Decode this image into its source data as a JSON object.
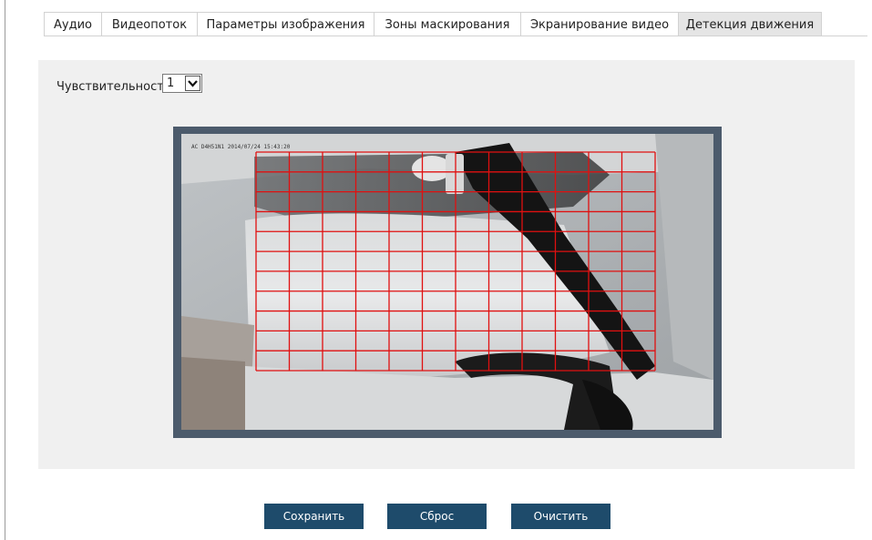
{
  "tabs": [
    {
      "label": "Аудио",
      "active": false
    },
    {
      "label": "Видеопоток",
      "active": false
    },
    {
      "label": "Параметры изображения",
      "active": false
    },
    {
      "label": "Зоны маскирования",
      "active": false
    },
    {
      "label": "Экранирование видео",
      "active": false
    },
    {
      "label": "Детекция движения",
      "active": true
    }
  ],
  "sensitivity": {
    "label": "Чувствительность:",
    "value": "1"
  },
  "video": {
    "osd_text": "AC D4H51N1 2014/07/24 15:43:20",
    "grid_color": "#e01010",
    "grid_columns": 12,
    "grid_rows": 11
  },
  "buttons": {
    "save": "Сохранить",
    "reset": "Сброс",
    "clear": "Очистить"
  },
  "colors": {
    "button_bg": "#1e4b6b",
    "panel_bg": "#f0f0f0",
    "video_border": "#4c5b6c",
    "active_tab_bg": "#e5e5e5"
  }
}
